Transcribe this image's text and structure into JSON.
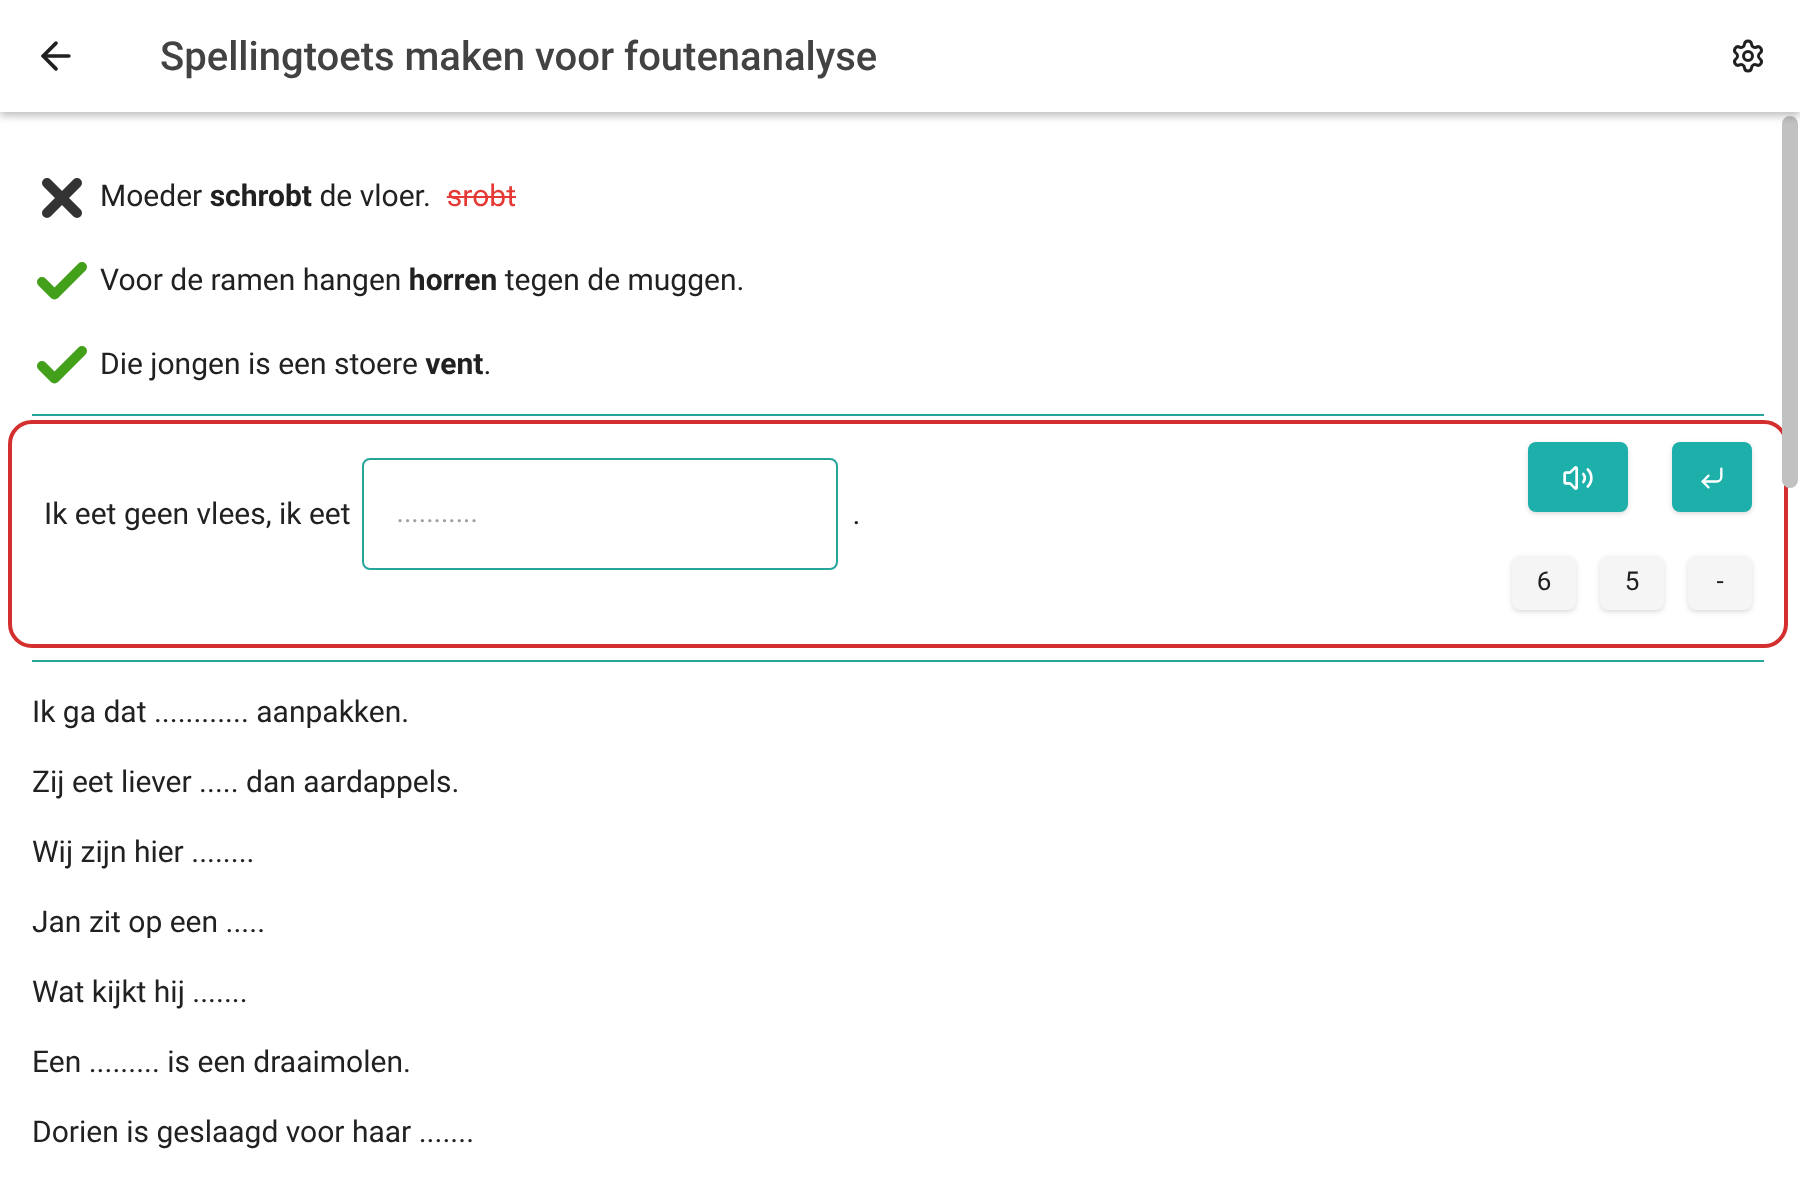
{
  "app_bar": {
    "title": "Spellingtoets maken voor foutenanalyse"
  },
  "answered": [
    {
      "kind": "wrong",
      "sentence": "Moeder **schrobt** de vloer.",
      "given": "srobt"
    },
    {
      "kind": "correct",
      "sentence": "Voor de ramen hangen **horren** tegen de muggen."
    },
    {
      "kind": "correct",
      "sentence": "Die jongen is een stoere **vent**."
    }
  ],
  "current": {
    "before": "Ik eet geen vlees, ik eet",
    "placeholder": "...........",
    "after": ".",
    "keys": [
      "6",
      "5",
      "-"
    ]
  },
  "upcoming": [
    "Ik ga dat ............ aanpakken.",
    "Zij eet liever ..... dan aardappels.",
    "Wij zijn hier ........",
    "Jan zit op een .....",
    "Wat kijkt hij .......",
    "Een ......... is een draaimolen.",
    "Dorien is geslaagd voor haar ......."
  ]
}
